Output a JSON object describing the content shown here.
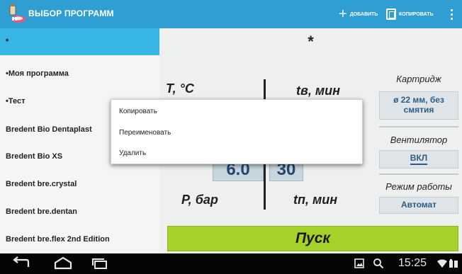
{
  "action_bar": {
    "title": "ВЫБОР ПРОГРАММ",
    "add_label": "ДОБАВИТЬ",
    "copy_label": "КОПИРОВАТЬ",
    "icons": [
      "app-icon",
      "plus-icon",
      "copy-icon",
      "overflow-menu-icon"
    ]
  },
  "sidebar": {
    "items": [
      {
        "label": "*",
        "selected": true
      },
      {
        "label": "•Моя программа",
        "selected": false
      },
      {
        "label": "•Тест",
        "selected": false
      },
      {
        "label": "Bredent Bio Dentaplast",
        "selected": false
      },
      {
        "label": "Bredent Bio XS",
        "selected": false
      },
      {
        "label": "Bredent bre.crystal",
        "selected": false
      },
      {
        "label": "Bredent bre.dentan",
        "selected": false
      },
      {
        "label": "Bredent bre.flex 2nd Edition",
        "selected": false
      }
    ]
  },
  "main": {
    "program_name": "*",
    "temp_label": "T, °C",
    "tv_label": "tв, мин",
    "pressure_label": "P, бар",
    "tp_label": "tп, мин",
    "pressure_value": "6.0",
    "tv_value": "30",
    "start_label": "Пуск"
  },
  "right_panel": {
    "cartridge_label": "Картридж",
    "cartridge_value": "ø 22 мм, без смятия",
    "fan_label": "Вентилятор",
    "fan_value": "ВКЛ",
    "mode_label": "Режим работы",
    "mode_value": "Автомат"
  },
  "context_menu": {
    "items": [
      "Копировать",
      "Переименовать",
      "Удалить"
    ]
  },
  "nav_bar": {
    "time": "15:25",
    "icons": [
      "back-icon",
      "home-icon",
      "recent-apps-icon",
      "screenshot-icon",
      "search-icon",
      "wifi-icon",
      "battery-icon"
    ]
  },
  "colors": {
    "action_bar": "#2f9fd3",
    "selected_item": "#38b6e6",
    "start_button": "#a6d129",
    "value_text": "#2a5d86"
  }
}
